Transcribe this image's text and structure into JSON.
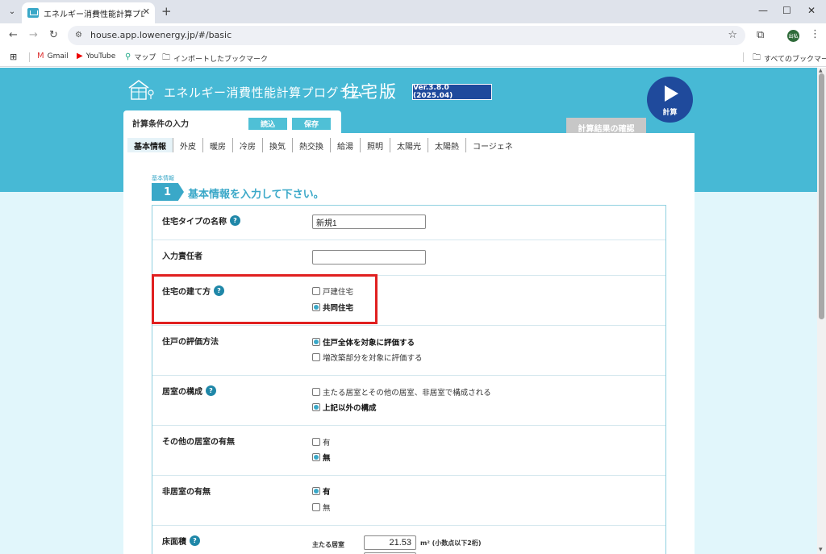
{
  "browser": {
    "tab_title": "エネルギー消費性能計算プログラム",
    "url": "house.app.lowenergy.jp/#/basic",
    "bookmarks": [
      {
        "label": "Gmail"
      },
      {
        "label": "YouTube"
      },
      {
        "label": "マップ"
      },
      {
        "label": "インポートしたブックマーク"
      }
    ],
    "all_bookmarks": "すべてのブックマーク",
    "profile_initials": "出私"
  },
  "header": {
    "title": "エネルギー消費性能計算プログラム",
    "title_big": "住宅版",
    "version": "Ver.3.8.0 (2025.04)",
    "calc_label": "計算",
    "cond_title": "計算条件の入力",
    "load_label": "読込",
    "save_label": "保存",
    "result_label": "計算結果の確認"
  },
  "tabs": [
    "基本情報",
    "外皮",
    "暖房",
    "冷房",
    "換気",
    "熱交換",
    "給湯",
    "照明",
    "太陽光",
    "太陽熱",
    "コージェネ"
  ],
  "step": {
    "small": "基本情報",
    "number": "1",
    "text": "基本情報を入力して下さい。"
  },
  "form": {
    "name": {
      "label": "住宅タイプの名称",
      "value": "新規1"
    },
    "person": {
      "label": "入力責任者",
      "value": ""
    },
    "build_type": {
      "label": "住宅の建て方",
      "options": [
        "戸建住宅",
        "共同住宅"
      ]
    },
    "eval_method": {
      "label": "住戸の評価方法",
      "options": [
        "住戸全体を対象に評価する",
        "増改築部分を対象に評価する"
      ]
    },
    "room_config": {
      "label": "居室の構成",
      "options": [
        "主たる居室とその他の居室、非居室で構成される",
        "上記以外の構成"
      ]
    },
    "other_rooms": {
      "label": "その他の居室の有無",
      "options": [
        "有",
        "無"
      ]
    },
    "non_rooms": {
      "label": "非居室の有無",
      "options": [
        "有",
        "無"
      ]
    },
    "floor_area": {
      "label": "床面積",
      "sub_label": "主たる居室",
      "value": "21.53",
      "unit": "m² (小数点以下2桁)"
    }
  }
}
